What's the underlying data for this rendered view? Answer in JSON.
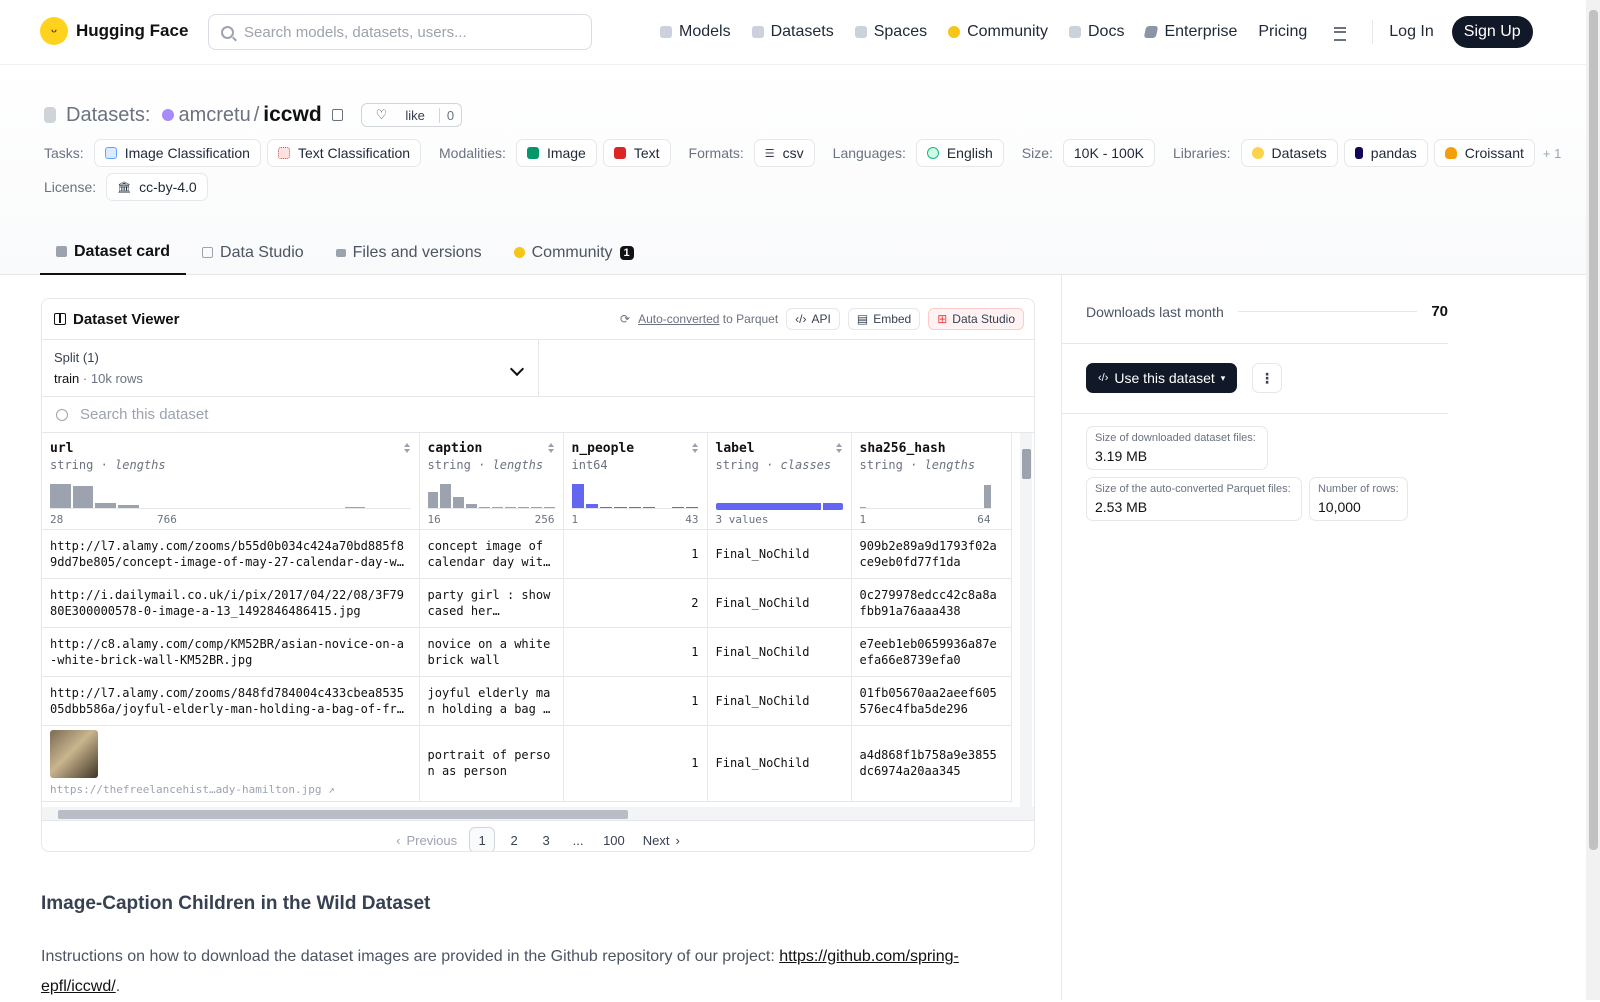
{
  "nav": {
    "brand": "Hugging Face",
    "search_placeholder": "Search models, datasets, users...",
    "items": [
      "Models",
      "Datasets",
      "Spaces",
      "Community",
      "Docs",
      "Enterprise",
      "Pricing"
    ],
    "login": "Log In",
    "signup": "Sign Up"
  },
  "header": {
    "prefix": "Datasets:",
    "owner": "amcretu",
    "slash": "/",
    "name": "iccwd",
    "like": "like",
    "like_count": "0",
    "tasks_label": "Tasks:",
    "tasks": [
      "Image Classification",
      "Text Classification"
    ],
    "modalities_label": "Modalities:",
    "modalities": [
      "Image",
      "Text"
    ],
    "formats_label": "Formats:",
    "format": "csv",
    "languages_label": "Languages:",
    "language": "English",
    "size_label": "Size:",
    "size": "10K - 100K",
    "libraries_label": "Libraries:",
    "libraries": [
      "Datasets",
      "pandas",
      "Croissant"
    ],
    "libraries_more": "+ 1",
    "license_label": "License:",
    "license": "cc-by-4.0"
  },
  "tabs": [
    "Dataset card",
    "Data Studio",
    "Files and versions",
    "Community"
  ],
  "community_count": "1",
  "viewer": {
    "title": "Dataset Viewer",
    "auto_converted": "Auto-converted",
    "to_parquet": "to Parquet",
    "api": "API",
    "embed": "Embed",
    "data_studio": "Data Studio",
    "split_label": "Split (1)",
    "split_name": "train",
    "split_dot": "·",
    "split_rows": "10k rows",
    "search_placeholder": "Search this dataset",
    "columns": [
      {
        "name": "url",
        "type": "string",
        "stat": "lengths",
        "min": "28",
        "max": "766"
      },
      {
        "name": "caption",
        "type": "string",
        "stat": "lengths",
        "min": "16",
        "max": "256"
      },
      {
        "name": "n_people",
        "type": "int64",
        "stat": "",
        "min": "1",
        "max": "43"
      },
      {
        "name": "label",
        "type": "string",
        "stat": "classes",
        "min": "3 values",
        "max": ""
      },
      {
        "name": "sha256_hash",
        "type": "string",
        "stat": "lengths",
        "min": "1",
        "max": "64"
      }
    ],
    "rows": [
      {
        "url": "http://l7.alamy.com/zooms/b55d0b034c424a70bd885f89dd7be805/concept-image-of-may-27-calendar-day-with-…",
        "caption": "concept image of calendar day with…",
        "n_people": "1",
        "label": "Final_NoChild",
        "sha": "909b2e89a9d1793f02ace9eb0fd77f1da"
      },
      {
        "url": "http://i.dailymail.co.uk/i/pix/2017/04/22/08/3F7980E300000578-0-image-a-13_1492846486415.jpg",
        "caption": "party girl : showcased her…",
        "n_people": "2",
        "label": "Final_NoChild",
        "sha": "0c279978edcc42c8a8afbb91a76aaa438"
      },
      {
        "url": "http://c8.alamy.com/comp/KM52BR/asian-novice-on-a-white-brick-wall-KM52BR.jpg",
        "caption": "novice on a white brick wall",
        "n_people": "1",
        "label": "Final_NoChild",
        "sha": "e7eeb1eb0659936a87eefa66e8739efa0"
      },
      {
        "url": "http://l7.alamy.com/zooms/848fd784004c433cbea853505dbb586a/joyful-elderly-man-holding-a-bag-of-fries-…",
        "caption": "joyful elderly man holding a bag of…",
        "n_people": "1",
        "label": "Final_NoChild",
        "sha": "01fb05670aa2aeef605576ec4fba5de296"
      },
      {
        "url": "https://thefreelancehist…ady-hamilton.jpg ↗",
        "caption": "portrait of person as person",
        "n_people": "1",
        "label": "Final_NoChild",
        "sha": "a4d868f1b758a9e3855dc6974a20aa345"
      }
    ],
    "pager": {
      "prev": "Previous",
      "pages": [
        "1",
        "2",
        "3",
        "...",
        "100"
      ],
      "next": "Next"
    }
  },
  "card": {
    "heading": "Image-Caption Children in the Wild Dataset",
    "text": "Instructions on how to download the dataset images are provided in the Github repository of our project: ",
    "link": "https://github.com/spring-epfl/iccwd/",
    "end": "."
  },
  "sidebar": {
    "downloads_label": "Downloads last month",
    "downloads": "70",
    "use_button": "Use this dataset",
    "size_dl_label": "Size of downloaded dataset files:",
    "size_dl": "3.19 MB",
    "size_pq_label": "Size of the auto-converted Parquet files:",
    "size_pq": "2.53 MB",
    "rows_label": "Number of rows:",
    "rows": "10,000"
  },
  "histograms": {
    "url": [
      0.9,
      0.8,
      0.2,
      0.1,
      0,
      0,
      0,
      0,
      0,
      0,
      0,
      0,
      0,
      0.05,
      0,
      0
    ],
    "caption": [
      0.6,
      0.9,
      0.4,
      0.15,
      0.05,
      0.05,
      0.05,
      0.05,
      0.05,
      0.05
    ],
    "n_people": [
      0.9,
      0.15,
      0.05,
      0.05,
      0.05,
      0.05,
      0,
      0.05,
      0.05
    ],
    "sha256_hash": [
      0.02,
      0,
      0,
      0,
      0,
      0,
      0,
      0,
      0,
      0,
      0,
      0,
      0,
      0,
      0,
      0.85
    ]
  }
}
